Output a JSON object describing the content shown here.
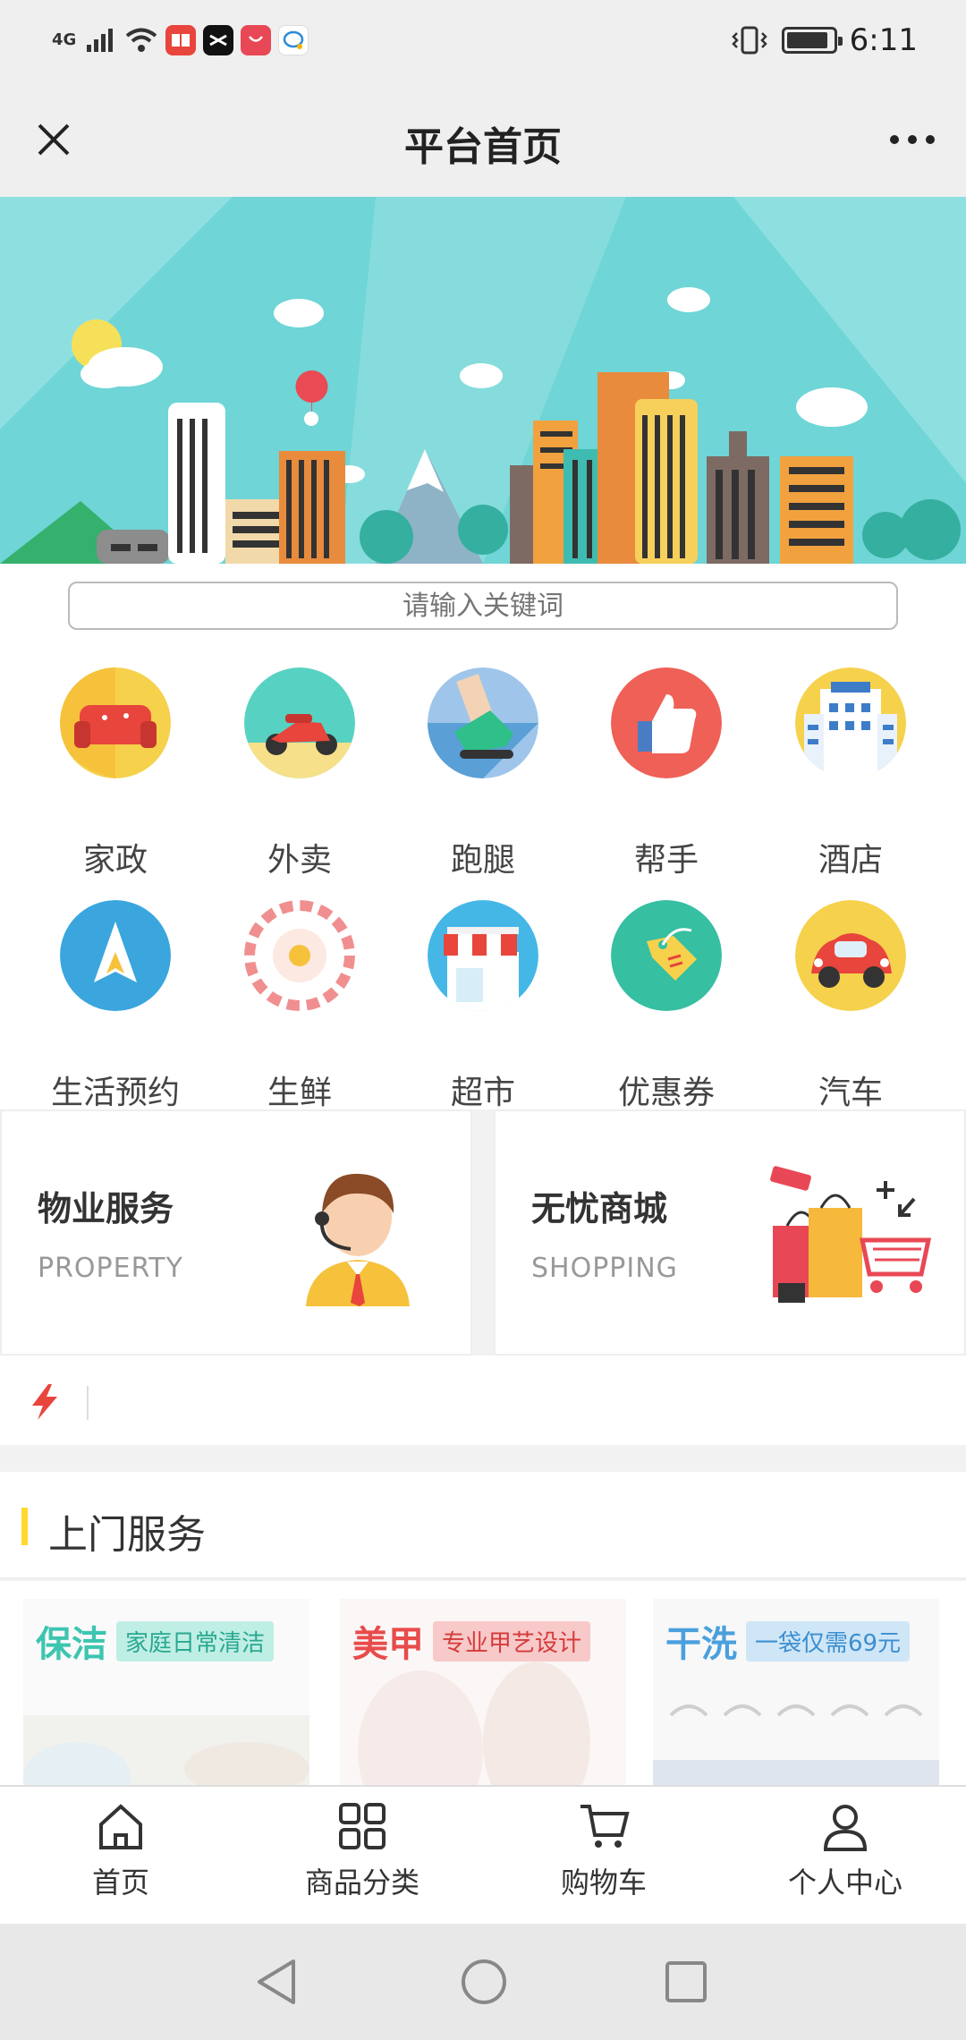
{
  "status_bar": {
    "network": "4G",
    "time": "6:11",
    "app_icons": [
      "book-app-icon",
      "capcut-icon",
      "huawei-store-icon",
      "chat-app-icon"
    ]
  },
  "nav": {
    "title": "平台首页",
    "close_icon": "close-icon",
    "more_icon": "more-icon"
  },
  "search": {
    "placeholder": "请输入关键词",
    "value": ""
  },
  "categories": [
    {
      "label": "家政",
      "icon": "sofa-icon",
      "bg": "#f6d14c"
    },
    {
      "label": "外卖",
      "icon": "scooter-icon",
      "bg": "#57d2c2"
    },
    {
      "label": "跑腿",
      "icon": "shoe-icon",
      "bg": "#5a9fd6"
    },
    {
      "label": "帮手",
      "icon": "thumbs-up-icon",
      "bg": "#ef6057"
    },
    {
      "label": "酒店",
      "icon": "hotel-icon",
      "bg": "#f6d14c"
    },
    {
      "label": "生活预约",
      "icon": "paper-plane-icon",
      "bg": "#3aa6dd"
    },
    {
      "label": "生鲜",
      "icon": "egg-plate-icon",
      "bg": "#f08f8f"
    },
    {
      "label": "超市",
      "icon": "store-icon",
      "bg": "#45b7e6"
    },
    {
      "label": "优惠券",
      "icon": "coupon-tag-icon",
      "bg": "#36bfa1"
    },
    {
      "label": "汽车",
      "icon": "car-icon",
      "bg": "#f6d14c"
    }
  ],
  "promos": [
    {
      "title": "物业服务",
      "subtitle": "PROPERTY",
      "icon": "customer-service-agent-icon"
    },
    {
      "title": "无忧商城",
      "subtitle": "SHOPPING",
      "icon": "shopping-cart-bags-icon"
    }
  ],
  "notice": {
    "icon": "lightning-icon",
    "text": ""
  },
  "section": {
    "title": "上门服务"
  },
  "services": [
    {
      "title": "保洁",
      "tag": "家庭日常清洁",
      "color": "#3dc5b0"
    },
    {
      "title": "美甲",
      "tag": "专业甲艺设计",
      "color": "#e84b4b"
    },
    {
      "title": "干洗",
      "tag": "一袋仅需69元",
      "color": "#4aa0dd"
    }
  ],
  "tabbar": [
    {
      "label": "首页",
      "icon": "home-icon"
    },
    {
      "label": "商品分类",
      "icon": "grid-icon"
    },
    {
      "label": "购物车",
      "icon": "cart-icon"
    },
    {
      "label": "个人中心",
      "icon": "user-icon"
    }
  ],
  "system_nav": [
    "back-icon",
    "home-circle-icon",
    "recents-icon"
  ],
  "colors": {
    "accent_yellow": "#ffd92e",
    "bolt_red": "#e8453c",
    "banner": "#6fd5d6"
  }
}
